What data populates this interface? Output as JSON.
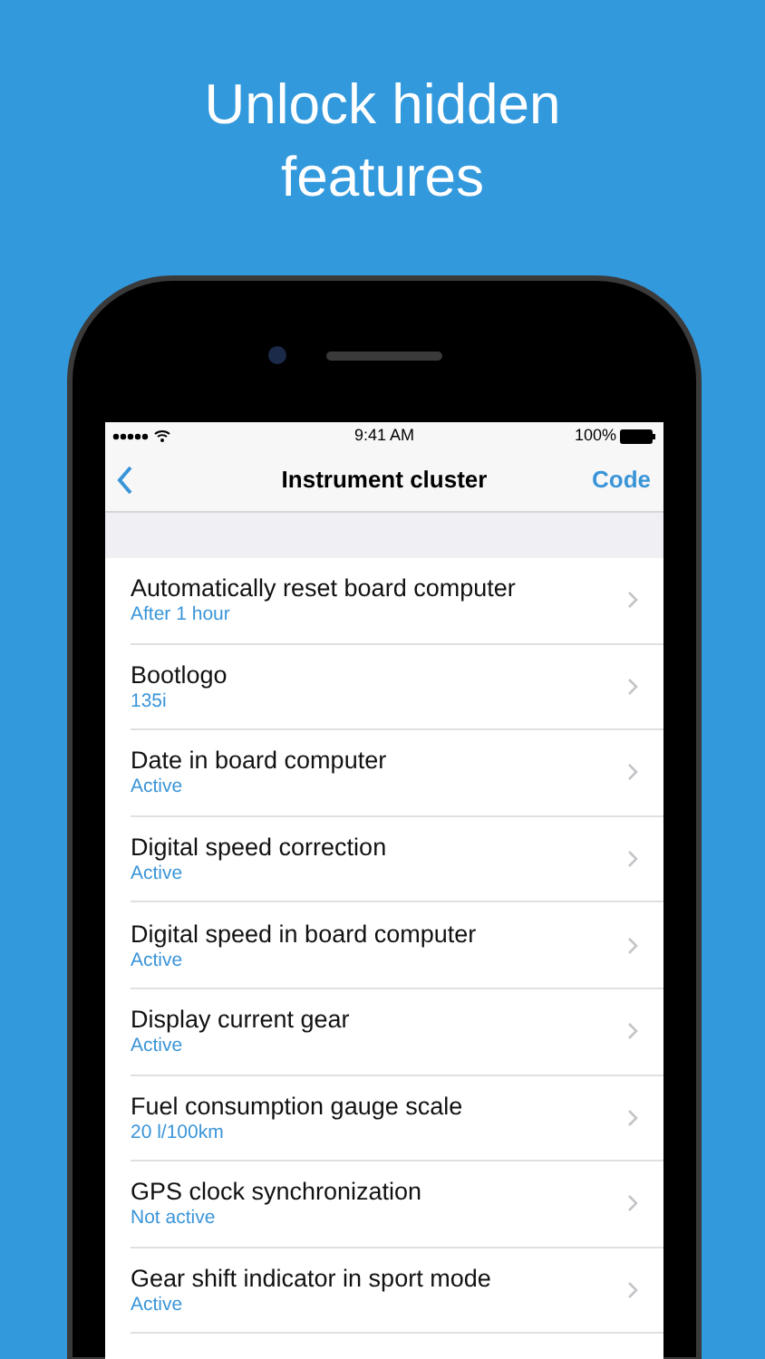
{
  "headline": "Unlock hidden features",
  "status_bar": {
    "time": "9:41 AM",
    "battery": "100%"
  },
  "nav": {
    "title": "Instrument cluster",
    "action": "Code"
  },
  "rows": [
    {
      "title": "Automatically reset board computer",
      "value": "After 1 hour"
    },
    {
      "title": "Bootlogo",
      "value": "135i"
    },
    {
      "title": "Date in board computer",
      "value": "Active"
    },
    {
      "title": "Digital speed correction",
      "value": "Active"
    },
    {
      "title": "Digital speed in board computer",
      "value": "Active"
    },
    {
      "title": "Display current gear",
      "value": "Active"
    },
    {
      "title": "Fuel consumption gauge scale",
      "value": "20 l/100km"
    },
    {
      "title": "GPS clock synchronization",
      "value": "Not active"
    },
    {
      "title": "Gear shift indicator in sport mode",
      "value": "Active"
    }
  ]
}
